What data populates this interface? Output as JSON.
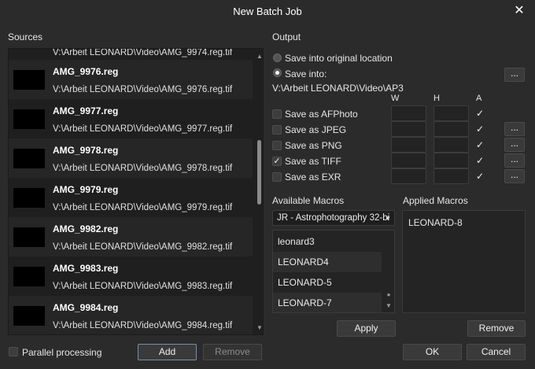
{
  "window": {
    "title": "New Batch Job",
    "close_glyph": "✕"
  },
  "sources": {
    "label": "Sources",
    "partial_path": "V:\\Arbeit LEONARD\\Video\\AMG_9974.reg.tif",
    "items": [
      {
        "name": "AMG_9976.reg",
        "path": "V:\\Arbeit LEONARD\\Video\\AMG_9976.reg.tif"
      },
      {
        "name": "AMG_9977.reg",
        "path": "V:\\Arbeit LEONARD\\Video\\AMG_9977.reg.tif"
      },
      {
        "name": "AMG_9978.reg",
        "path": "V:\\Arbeit LEONARD\\Video\\AMG_9978.reg.tif"
      },
      {
        "name": "AMG_9979.reg",
        "path": "V:\\Arbeit LEONARD\\Video\\AMG_9979.reg.tif"
      },
      {
        "name": "AMG_9982.reg",
        "path": "V:\\Arbeit LEONARD\\Video\\AMG_9982.reg.tif"
      },
      {
        "name": "AMG_9983.reg",
        "path": "V:\\Arbeit LEONARD\\Video\\AMG_9983.reg.tif"
      },
      {
        "name": "AMG_9984.reg",
        "path": "V:\\Arbeit LEONARD\\Video\\AMG_9984.reg.tif"
      }
    ]
  },
  "parallel_processing": {
    "label": "Parallel processing",
    "checked": false
  },
  "buttons": {
    "add": "Add",
    "remove_source": "Remove",
    "apply": "Apply",
    "remove_macro": "Remove",
    "ok": "OK",
    "cancel": "Cancel",
    "browse": "..."
  },
  "output": {
    "label": "Output",
    "original_location": "Save into original location",
    "save_into": "Save into:",
    "selected": "save_into",
    "path": "V:\\Arbeit LEONARD\\Video\\AP3",
    "col_w": "W",
    "col_h": "H",
    "col_a": "A",
    "formats": [
      {
        "label": "Save as AFPhoto",
        "checked": false,
        "a": true,
        "browse": false
      },
      {
        "label": "Save as JPEG",
        "checked": false,
        "a": true,
        "browse": true
      },
      {
        "label": "Save as PNG",
        "checked": false,
        "a": true,
        "browse": true
      },
      {
        "label": "Save as TIFF",
        "checked": true,
        "a": true,
        "browse": true
      },
      {
        "label": "Save as EXR",
        "checked": false,
        "a": true,
        "browse": true
      }
    ]
  },
  "macros": {
    "available_label": "Available Macros",
    "applied_label": "Applied Macros",
    "category": "JR - Astrophotography 32-bi",
    "available": [
      "leonard3",
      "LEONARD4",
      "LEONARD-5",
      "LEONARD-7"
    ],
    "applied": [
      "LEONARD-8"
    ]
  },
  "colors": {
    "background": "#2b2b2b",
    "list_bg": "#1f1f1f",
    "primary_border": "#7a8fb0"
  },
  "icons": {
    "close": "close-icon",
    "scroll_up": "triangle-up-icon",
    "scroll_down": "triangle-down-icon",
    "dropdown": "chevron-down-icon",
    "check": "checkmark-icon"
  }
}
